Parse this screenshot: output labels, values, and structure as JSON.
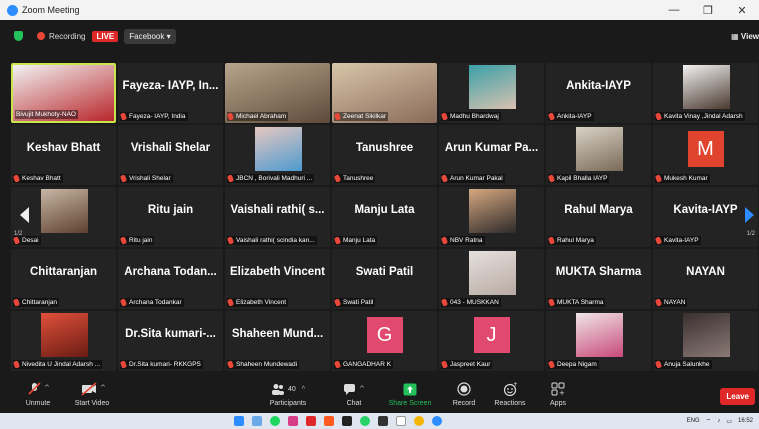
{
  "window": {
    "title": "Zoom Meeting",
    "minimize": "—",
    "maximize": "❐",
    "close": "✕"
  },
  "topbar": {
    "recording": "Recording",
    "live": "LIVE",
    "stream": "Facebook ▾",
    "view": "▦ View"
  },
  "gallery": {
    "page_left": "1/2",
    "page_right": "1/2",
    "tiles": [
      {
        "label": "Bivujit Mukhoty-NAO",
        "big": "",
        "type": "photo",
        "active": true,
        "colors": [
          "#f2f2f2",
          "#b8262b"
        ]
      },
      {
        "label": "Fayeza- IAYP, India",
        "big": "Fayeza- IAYP, In...",
        "type": "name"
      },
      {
        "label": "Michael Abraham",
        "big": "",
        "type": "photo",
        "colors": [
          "#b9a58c",
          "#5e4a3a"
        ]
      },
      {
        "label": "Zeenat Sikilkar",
        "big": "",
        "type": "photo",
        "colors": [
          "#d8c6a8",
          "#8a6a5a"
        ]
      },
      {
        "label": "Madhu Bhardwaj",
        "big": "",
        "type": "photo",
        "colors": [
          "#3aa0a8",
          "#d9c2b0"
        ]
      },
      {
        "label": "Ankita-IAYP",
        "big": "Ankita-IAYP",
        "type": "name"
      },
      {
        "label": "Kavita Vinay ,Jindal Adarsh",
        "big": "",
        "type": "photo",
        "colors": [
          "#f2f2f2",
          "#4a3a30"
        ]
      },
      {
        "label": "Keshav Bhatt",
        "big": "Keshav Bhatt",
        "type": "name"
      },
      {
        "label": "Vrishali Shelar",
        "big": "Vrishali Shelar",
        "type": "name"
      },
      {
        "label": "JBCN , Borivali Madhuri ...",
        "big": "",
        "type": "photo",
        "colors": [
          "#e6c8c0",
          "#4e9ad0"
        ]
      },
      {
        "label": "Tanushree",
        "big": "Tanushree",
        "type": "name"
      },
      {
        "label": "Arun Kumar Pakal",
        "big": "Arun Kumar Pa...",
        "type": "name"
      },
      {
        "label": "Kapil Bhalla IAYP",
        "big": "",
        "type": "photo",
        "colors": [
          "#d9d3c6",
          "#7a6a58"
        ]
      },
      {
        "label": "Mukesh Kumar",
        "big": "M",
        "type": "avatar",
        "color": "#e0432e"
      },
      {
        "label": "Desai",
        "big": "",
        "type": "photo",
        "colors": [
          "#c8b6a4",
          "#5e4030"
        ]
      },
      {
        "label": "Ritu jain",
        "big": "Ritu jain",
        "type": "name"
      },
      {
        "label": "Vaishali rathi( scindia kan...",
        "big": "Vaishali rathi( s...",
        "type": "name"
      },
      {
        "label": "Manju Lata",
        "big": "Manju Lata",
        "type": "name"
      },
      {
        "label": "NBV Ratna",
        "big": "",
        "type": "photo",
        "colors": [
          "#d6a880",
          "#2e2a2a"
        ]
      },
      {
        "label": "Rahul Marya",
        "big": "Rahul Marya",
        "type": "name"
      },
      {
        "label": "Kavita-IAYP",
        "big": "Kavita-IAYP",
        "type": "name"
      },
      {
        "label": "Chittaranjan",
        "big": "Chittaranjan",
        "type": "name"
      },
      {
        "label": "Archana Todankar",
        "big": "Archana Todan...",
        "type": "name"
      },
      {
        "label": "Elizabeth Vincent",
        "big": "Elizabeth Vincent",
        "type": "name"
      },
      {
        "label": "Swati Patil",
        "big": "Swati Patil",
        "type": "name"
      },
      {
        "label": "043 - MUSKKAN",
        "big": "",
        "type": "photo",
        "colors": [
          "#e6e0dc",
          "#b8aaa4"
        ]
      },
      {
        "label": "MUKTA Sharma",
        "big": "MUKTA Sharma",
        "type": "name"
      },
      {
        "label": "NAYAN",
        "big": "NAYAN",
        "type": "name"
      },
      {
        "label": "Nivedita U Jindal Adarsh ...",
        "big": "",
        "type": "photo",
        "colors": [
          "#e0503a",
          "#6a1c14"
        ]
      },
      {
        "label": "Dr.Sita kumari- RKKGPS",
        "big": "Dr.Sita kumari-...",
        "type": "name"
      },
      {
        "label": "Shaheen Mundewadi",
        "big": "Shaheen Mund...",
        "type": "name"
      },
      {
        "label": "GANGADHAR K",
        "big": "G",
        "type": "avatar",
        "color": "#e14a6e"
      },
      {
        "label": "Jaspreet Kaur",
        "big": "J",
        "type": "avatar",
        "color": "#e14a6e"
      },
      {
        "label": "Deepa Nigam",
        "big": "",
        "type": "photo",
        "colors": [
          "#f0e6e8",
          "#c84a78"
        ]
      },
      {
        "label": "Anuja Salunkhe",
        "big": "",
        "type": "photo",
        "colors": [
          "#3a3030",
          "#8a7a76"
        ]
      }
    ]
  },
  "toolbar": {
    "unmute": "Unmute",
    "start_video": "Start Video",
    "participants": "Participants",
    "participants_count": "40",
    "chat": "Chat",
    "share": "Share Screen",
    "record": "Record",
    "reactions": "Reactions",
    "apps": "Apps",
    "leave": "Leave"
  },
  "taskbar": {
    "lang": "ENG",
    "time": "16:52",
    "notif": "99+",
    "badge": "3"
  }
}
